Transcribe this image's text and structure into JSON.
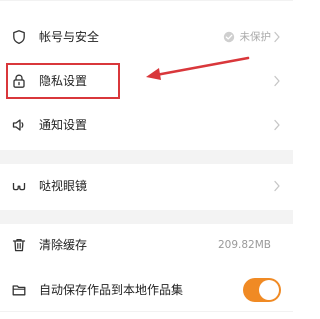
{
  "settings": {
    "account_security": {
      "icon": "shield-icon",
      "label": "帐号与安全",
      "status": "未保护",
      "status_icon": "check-circle-icon"
    },
    "privacy": {
      "icon": "lock-icon",
      "label": "隐私设置"
    },
    "notifications": {
      "icon": "speaker-icon",
      "label": "通知设置"
    },
    "glasses": {
      "icon": "glasses-icon",
      "label": "哒视眼镜"
    },
    "clear_cache": {
      "icon": "trash-icon",
      "label": "清除缓存",
      "size": "209.82MB"
    },
    "auto_save": {
      "icon": "folder-icon",
      "label": "自动保存作品到本地作品集",
      "enabled": true
    }
  },
  "annotation": {
    "highlight_color": "#d9373b",
    "arrow_color": "#d9373b"
  },
  "colors": {
    "toggle_on": "#f08a24",
    "section_separator": "#f3f3f3",
    "secondary_text": "#aaaaaa"
  }
}
